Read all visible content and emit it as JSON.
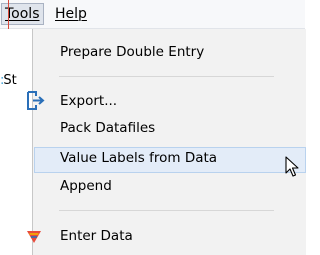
{
  "menubar": {
    "items": [
      {
        "label": "Tools",
        "active": true
      },
      {
        "label": "Help",
        "active": false
      }
    ]
  },
  "background_window": {
    "partial_text": "St"
  },
  "tools_menu": {
    "items": [
      {
        "label": "Prepare Double Entry",
        "icon": null
      },
      {
        "label": "Export...",
        "icon": "export-icon"
      },
      {
        "label": "Pack Datafiles",
        "icon": null
      },
      {
        "label": "Value Labels from Data",
        "icon": null,
        "hovered": true
      },
      {
        "label": "Append",
        "icon": null
      },
      {
        "label": "Enter Data",
        "icon": "enter-data-icon"
      }
    ]
  },
  "colors": {
    "menu_bg": "#f2f2f2",
    "hover_bg": "#e3ecf8",
    "hover_border": "#b9d2ee",
    "accent_red": "#d84a3b",
    "export_icon": "#2a6fb8"
  }
}
